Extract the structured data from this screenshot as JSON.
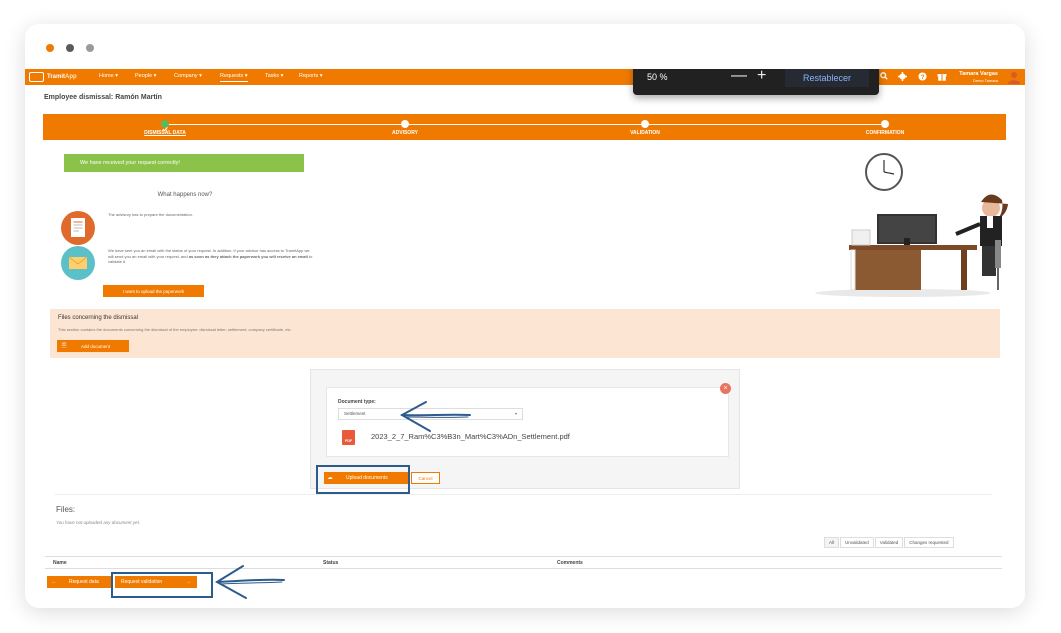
{
  "window": {
    "traffic_lights": [
      "orange",
      "dark-gray",
      "light-gray"
    ]
  },
  "navbar": {
    "logo_prefix": "Tramit",
    "logo_suffix": "App",
    "items": [
      {
        "label": "Home ▾"
      },
      {
        "label": "People ▾"
      },
      {
        "label": "Company ▾"
      },
      {
        "label": "Requests ▾",
        "active": true
      },
      {
        "label": "Tasks ▾"
      },
      {
        "label": "Reports ▾"
      }
    ],
    "user_name": "Tamara Vargas",
    "user_company": "Demo Tamara",
    "icons": [
      "search-icon",
      "gear-icon",
      "help-icon",
      "gift-icon"
    ]
  },
  "zoom_popup": {
    "level": "50 %",
    "minus": "—",
    "plus": "+",
    "reset": "Restablecer"
  },
  "page": {
    "title": "Employee dismissal: Ramón Martín"
  },
  "stepper": {
    "steps": [
      {
        "label": "DISMISSAL DATA",
        "state": "done",
        "current": true
      },
      {
        "label": "ADVISORY",
        "state": "pending"
      },
      {
        "label": "VALIDATION",
        "state": "pending"
      },
      {
        "label": "CONFIRMATION",
        "state": "pending"
      }
    ]
  },
  "status": {
    "banner": "We have received your request correctly!",
    "what_happens": "What happens now?",
    "step1_text": "The advisory has to prepare the documentation.",
    "step2_text_a": "We have sent you an email with the status of your request. In addition, if your advisor has access to TramitApp we will send you an email with your request, and ",
    "step2_text_bold": "as soon as they attach the paperwork you will receive an email",
    "step2_text_b": " to validate it.",
    "upload_paperwork_button": "I want to upload the paperwork"
  },
  "files_dismissal": {
    "title": "Files concerning the dismissal",
    "description": "This section contains the documents concerning the dismissal of the employee: dismissal letter, settlement, company certificate, etc.",
    "add_button": "Add document"
  },
  "upload_panel": {
    "doc_type_label": "Document type:",
    "doc_type_value": "Settlement",
    "pdf_badge": "PDF",
    "file_name": "2023_2_7_Ram%C3%B3n_Mart%C3%ADn_Settlement.pdf",
    "upload_button": "Upload documents",
    "cancel_button": "Cancel"
  },
  "files": {
    "heading": "Files:",
    "empty_message": "You have not uploaded any document yet.",
    "filters": [
      {
        "label": "All",
        "active": true
      },
      {
        "label": "Unvalidated"
      },
      {
        "label": "Validated"
      },
      {
        "label": "Changes requested"
      }
    ],
    "columns": [
      "Name",
      "Status",
      "Comments"
    ]
  },
  "footer": {
    "back_button": "Request data",
    "next_button": "Request validation"
  },
  "colors": {
    "brand_orange": "#f07a00",
    "success_green": "#8bc34a",
    "highlight_blue": "#2d5b8c",
    "panel_peach": "#fce6d3"
  }
}
